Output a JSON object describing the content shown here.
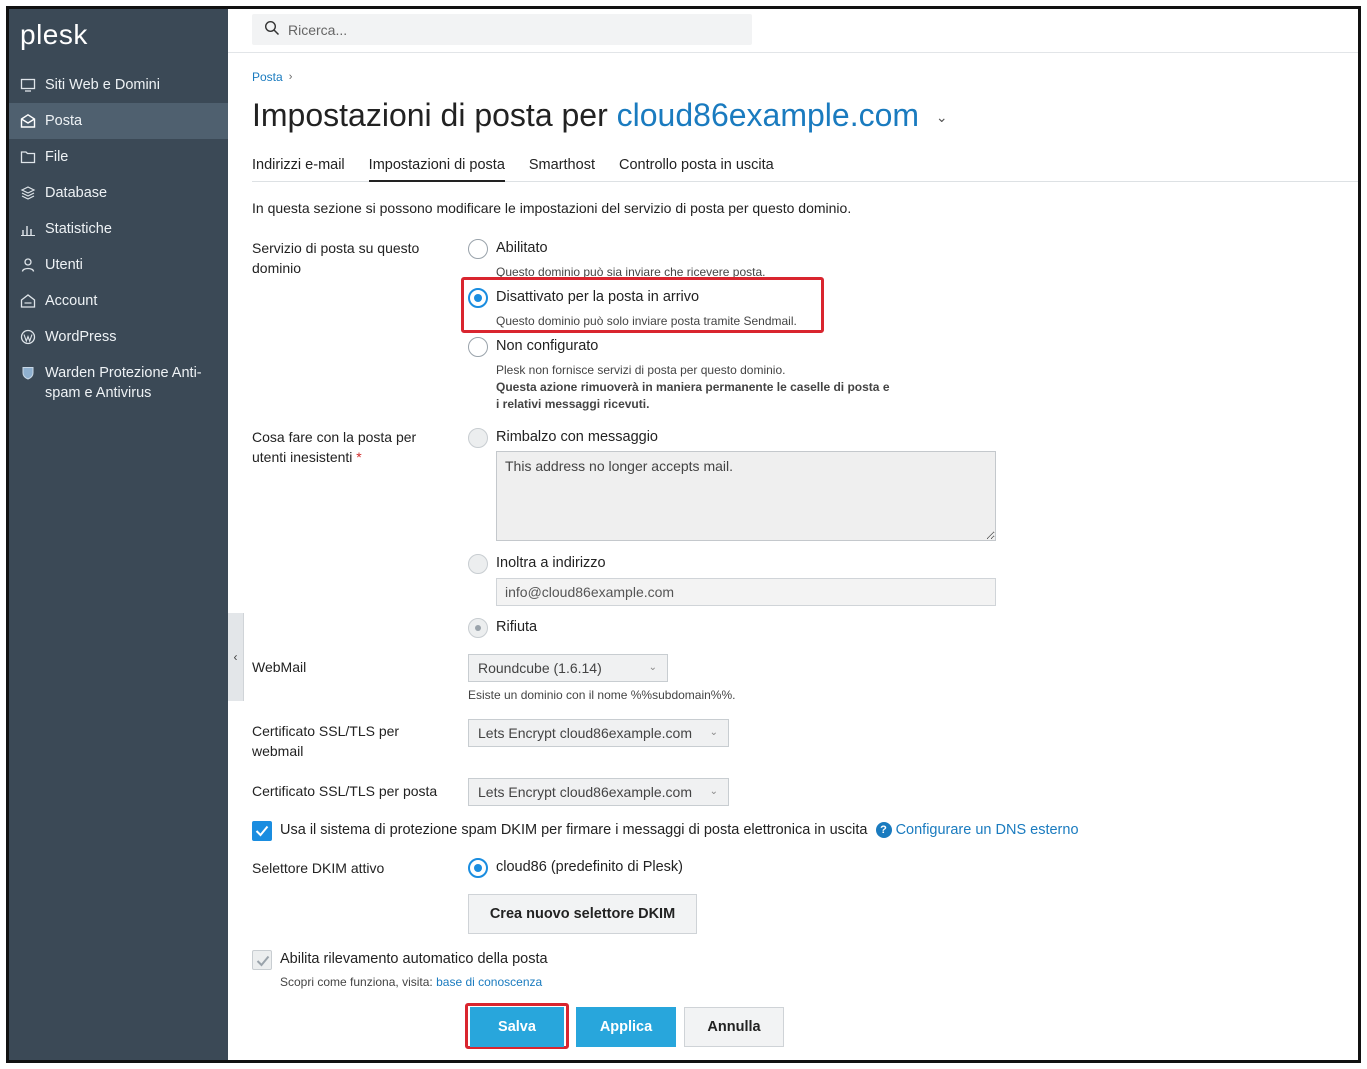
{
  "app": {
    "logo": "plesk"
  },
  "sidebar": {
    "items": [
      {
        "label": "Siti Web e Domini",
        "icon": "monitor-icon",
        "active": false
      },
      {
        "label": "Posta",
        "icon": "mail-icon",
        "active": true
      },
      {
        "label": "File",
        "icon": "folder-icon",
        "active": false
      },
      {
        "label": "Database",
        "icon": "database-icon",
        "active": false
      },
      {
        "label": "Statistiche",
        "icon": "chart-icon",
        "active": false
      },
      {
        "label": "Utenti",
        "icon": "user-icon",
        "active": false
      },
      {
        "label": "Account",
        "icon": "account-icon",
        "active": false
      },
      {
        "label": "WordPress",
        "icon": "wordpress-icon",
        "active": false
      },
      {
        "label": "Warden Protezione Anti-spam e Antivirus",
        "icon": "shield-icon",
        "active": false
      }
    ]
  },
  "search": {
    "placeholder": "Ricerca..."
  },
  "breadcrumb": {
    "label": "Posta",
    "separator": "›"
  },
  "page": {
    "title_prefix": "Impostazioni di posta per",
    "domain": "cloud86example.com",
    "caret": "⌄"
  },
  "tabs": [
    {
      "label": "Indirizzi e-mail",
      "active": false
    },
    {
      "label": "Impostazioni di posta",
      "active": true
    },
    {
      "label": "Smarthost",
      "active": false
    },
    {
      "label": "Controllo posta in uscita",
      "active": false
    }
  ],
  "intro": "In questa sezione si possono modificare le impostazioni del servizio di posta per questo dominio.",
  "mail_service": {
    "label": "Servizio di posta su questo dominio",
    "options": [
      {
        "label": "Abilitato",
        "hint": "Questo dominio può sia inviare che ricevere posta."
      },
      {
        "label": "Disattivato per la posta in arrivo",
        "hint": "Questo dominio può solo inviare posta tramite Sendmail."
      },
      {
        "label": "Non configurato",
        "hint": "Plesk non fornisce servizi di posta per questo dominio.",
        "warning": "Questa azione rimuoverà in maniera permanente le caselle di posta e i relativi messaggi ricevuti."
      }
    ]
  },
  "nonexistent": {
    "label": "Cosa fare con la posta per utenti inesistenti",
    "required_mark": "*",
    "bounce_label": "Rimbalzo con messaggio",
    "bounce_message": "This address no longer accepts mail.",
    "forward_label": "Inoltra a indirizzo",
    "forward_value": "info@cloud86example.com",
    "reject_label": "Rifiuta"
  },
  "webmail": {
    "label": "WebMail",
    "value": "Roundcube (1.6.14)",
    "hint": "Esiste un dominio con il nome %%subdomain%%."
  },
  "ssl_webmail": {
    "label": "Certificato SSL/TLS per webmail",
    "value": "Lets Encrypt cloud86example.com"
  },
  "ssl_mail": {
    "label": "Certificato SSL/TLS per posta",
    "value": "Lets Encrypt cloud86example.com"
  },
  "dkim": {
    "checkbox_label": "Usa il sistema di protezione spam DKIM per firmare i messaggi di posta elettronica in uscita",
    "help_glyph": "?",
    "dns_link": "Configurare un DNS esterno",
    "selector_label": "Selettore DKIM attivo",
    "selector_value": "cloud86 (predefinito di Plesk)",
    "create_button": "Crea nuovo selettore DKIM"
  },
  "autodiscover": {
    "label": "Abilita rilevamento automatico della posta",
    "hint_prefix": "Scopri come funziona, visita:",
    "hint_link": "base di conoscenza"
  },
  "buttons": {
    "save": "Salva",
    "apply": "Applica",
    "cancel": "Annulla"
  },
  "colors": {
    "sidebar_bg": "#3b4956",
    "accent": "#1a8de0",
    "link": "#1a7bbf",
    "primary_button": "#28a6dc",
    "highlight": "#d9252f"
  }
}
